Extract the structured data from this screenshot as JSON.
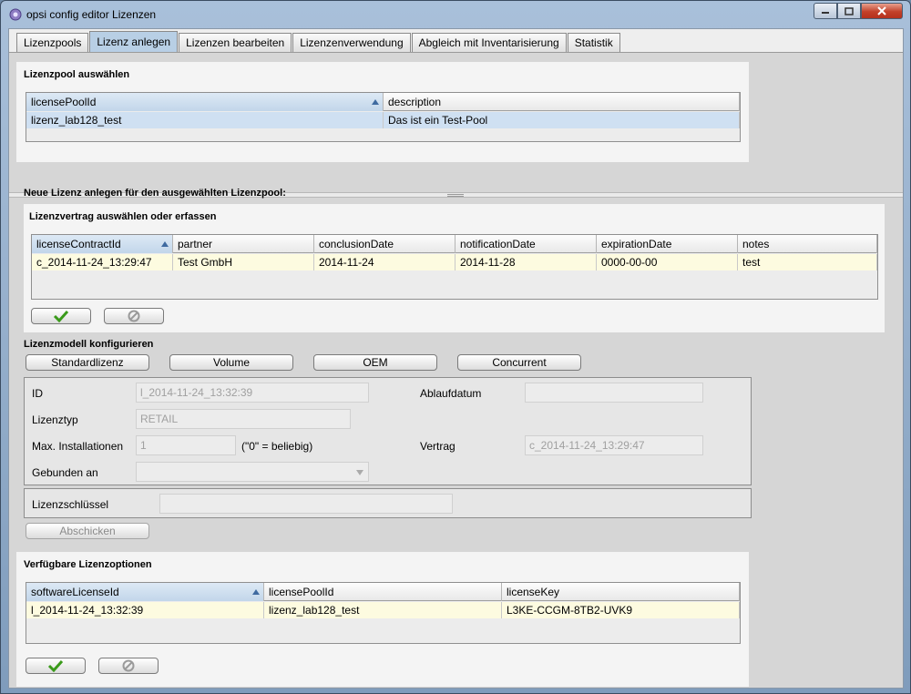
{
  "window": {
    "title": "opsi config editor Lizenzen"
  },
  "tabs": [
    {
      "label": "Lizenzpools"
    },
    {
      "label": "Lizenz anlegen"
    },
    {
      "label": "Lizenzen bearbeiten"
    },
    {
      "label": "Lizenzenverwendung"
    },
    {
      "label": "Abgleich mit Inventarisierung"
    },
    {
      "label": "Statistik"
    }
  ],
  "active_tab": "Lizenz anlegen",
  "pool_section": {
    "heading": "Lizenzpool auswählen",
    "columns": [
      "licensePoolId",
      "description"
    ],
    "rows": [
      [
        "lizenz_lab128_test",
        "Das ist ein Test-Pool"
      ]
    ]
  },
  "new_license": {
    "heading": "Neue Lizenz anlegen für den ausgewählten Lizenzpool:",
    "contract": {
      "heading": "Lizenzvertrag auswählen oder erfassen",
      "columns": [
        "licenseContractId",
        "partner",
        "conclusionDate",
        "notificationDate",
        "expirationDate",
        "notes"
      ],
      "rows": [
        [
          "c_2014-11-24_13:29:47",
          "Test GmbH",
          "2014-11-24",
          "2014-11-28",
          "0000-00-00",
          "test"
        ]
      ]
    },
    "model": {
      "heading": "Lizenzmodell konfigurieren",
      "buttons": [
        "Standardlizenz",
        "Volume",
        "OEM",
        "Concurrent"
      ]
    },
    "form": {
      "id_label": "ID",
      "id_value": "l_2014-11-24_13:32:39",
      "expiry_label": "Ablaufdatum",
      "expiry_value": "",
      "type_label": "Lizenztyp",
      "type_value": "RETAIL",
      "max_label": "Max. Installationen",
      "max_value": "1",
      "max_hint": "(\"0\" = beliebig)",
      "contract_label": "Vertrag",
      "contract_value": "c_2014-11-24_13:29:47",
      "bound_label": "Gebunden an",
      "bound_value": "",
      "key_label": "Lizenzschlüssel",
      "key_value": ""
    },
    "submit_label": "Abschicken"
  },
  "options_section": {
    "heading": "Verfügbare Lizenzoptionen",
    "columns": [
      "softwareLicenseId",
      "licensePoolId",
      "licenseKey"
    ],
    "rows": [
      [
        "l_2014-11-24_13:32:39",
        "lizenz_lab128_test",
        "L3KE-CCGM-8TB2-UVK9"
      ]
    ]
  },
  "colors": {
    "titlebar": "#a9c0da",
    "active_tab": "#b8cfe5",
    "selected_row_blue": "#cfe0f2",
    "selected_row_cream": "#fdfbe0",
    "close_button": "#c2412a",
    "confirm_check": "#3a9a1a"
  },
  "icons": [
    "app-icon",
    "minimize-icon",
    "maximize-icon",
    "close-icon",
    "sort-ascending-icon",
    "confirm-check-icon",
    "cancel-icon",
    "dropdown-arrow-icon"
  ]
}
